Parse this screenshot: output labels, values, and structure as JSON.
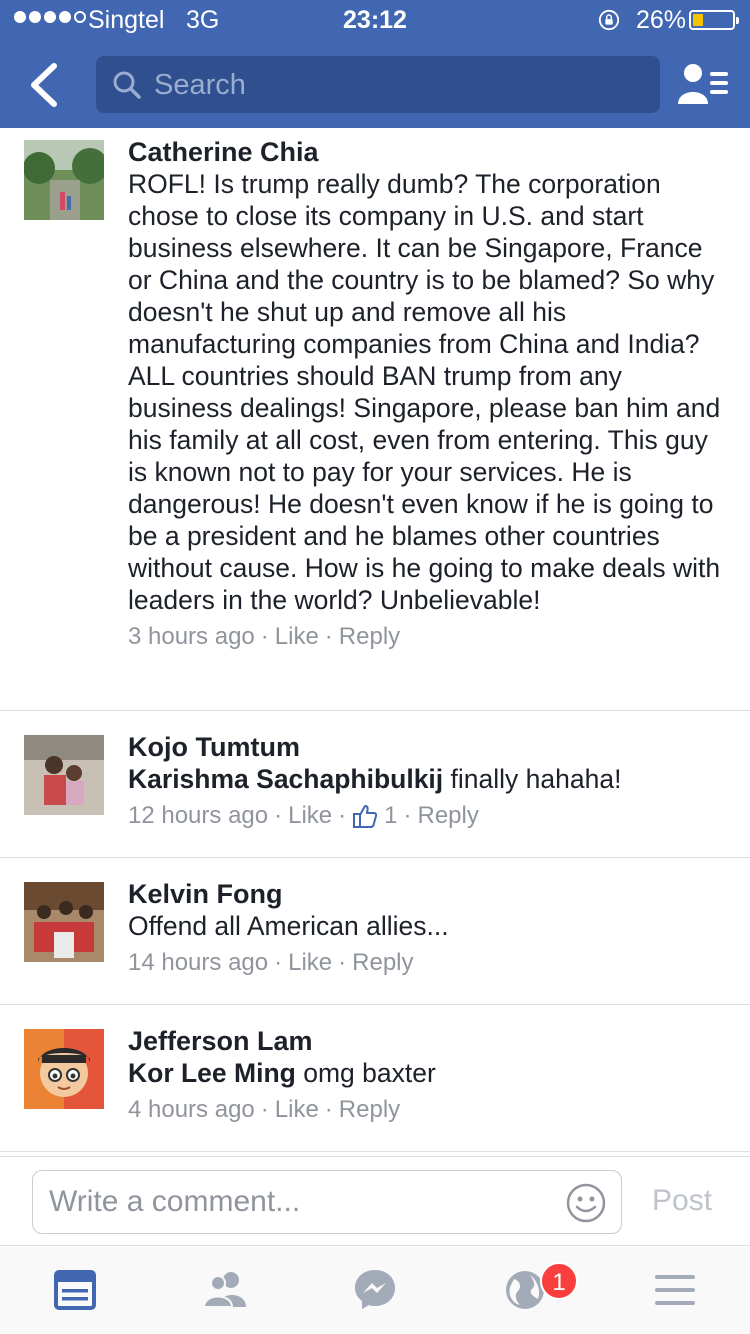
{
  "status_bar": {
    "carrier": "Singtel",
    "network": "3G",
    "time": "23:12",
    "battery_percent": "26%",
    "battery_level": 0.26,
    "signal_bars_filled": 4,
    "signal_bars_total": 5
  },
  "header": {
    "search_placeholder": "Search",
    "back_icon": "chevron-left-icon",
    "friends_icon": "friend-requests-icon"
  },
  "comments": [
    {
      "author": "Catherine Chia",
      "mention": "",
      "text": "ROFL! Is trump really dumb?  The corporation chose to close its company in U.S. and start business elsewhere. It can be Singapore, France or China and the country is to be blamed? So why doesn't he shut up and remove all his manufacturing companies from China and India? ALL countries should BAN trump from any business dealings! Singapore, please ban him and his family at all cost, even from entering. This guy is known not to pay for your services. He is dangerous! He doesn't even know if he is going to be a president and he blames other countries  without cause. How is he going to make deals with leaders in the world? Unbelievable!",
      "time": "3 hours ago",
      "like": "Like",
      "reply": "Reply",
      "like_count": ""
    },
    {
      "author": "Kojo Tumtum",
      "mention": "Karishma Sachaphibulkij",
      "text": "finally hahaha!",
      "time": "12 hours ago",
      "like": "Like",
      "reply": "Reply",
      "like_count": "1"
    },
    {
      "author": "Kelvin Fong",
      "mention": "",
      "text": "Offend all American allies...",
      "time": "14 hours ago",
      "like": "Like",
      "reply": "Reply",
      "like_count": ""
    },
    {
      "author": "Jefferson Lam",
      "mention": "Kor Lee Ming",
      "text": "omg baxter",
      "time": "4 hours ago",
      "like": "Like",
      "reply": "Reply",
      "like_count": ""
    }
  ],
  "composer": {
    "placeholder": "Write a comment...",
    "post_label": "Post"
  },
  "tabbar": {
    "tabs": [
      "news-feed-icon",
      "friends-icon",
      "messenger-icon",
      "notifications-globe-icon",
      "menu-icon"
    ],
    "notification_badge": "1"
  },
  "colors": {
    "brand": "#4267b2",
    "link_active": "#4267b2",
    "badge": "#fa3e3e"
  }
}
